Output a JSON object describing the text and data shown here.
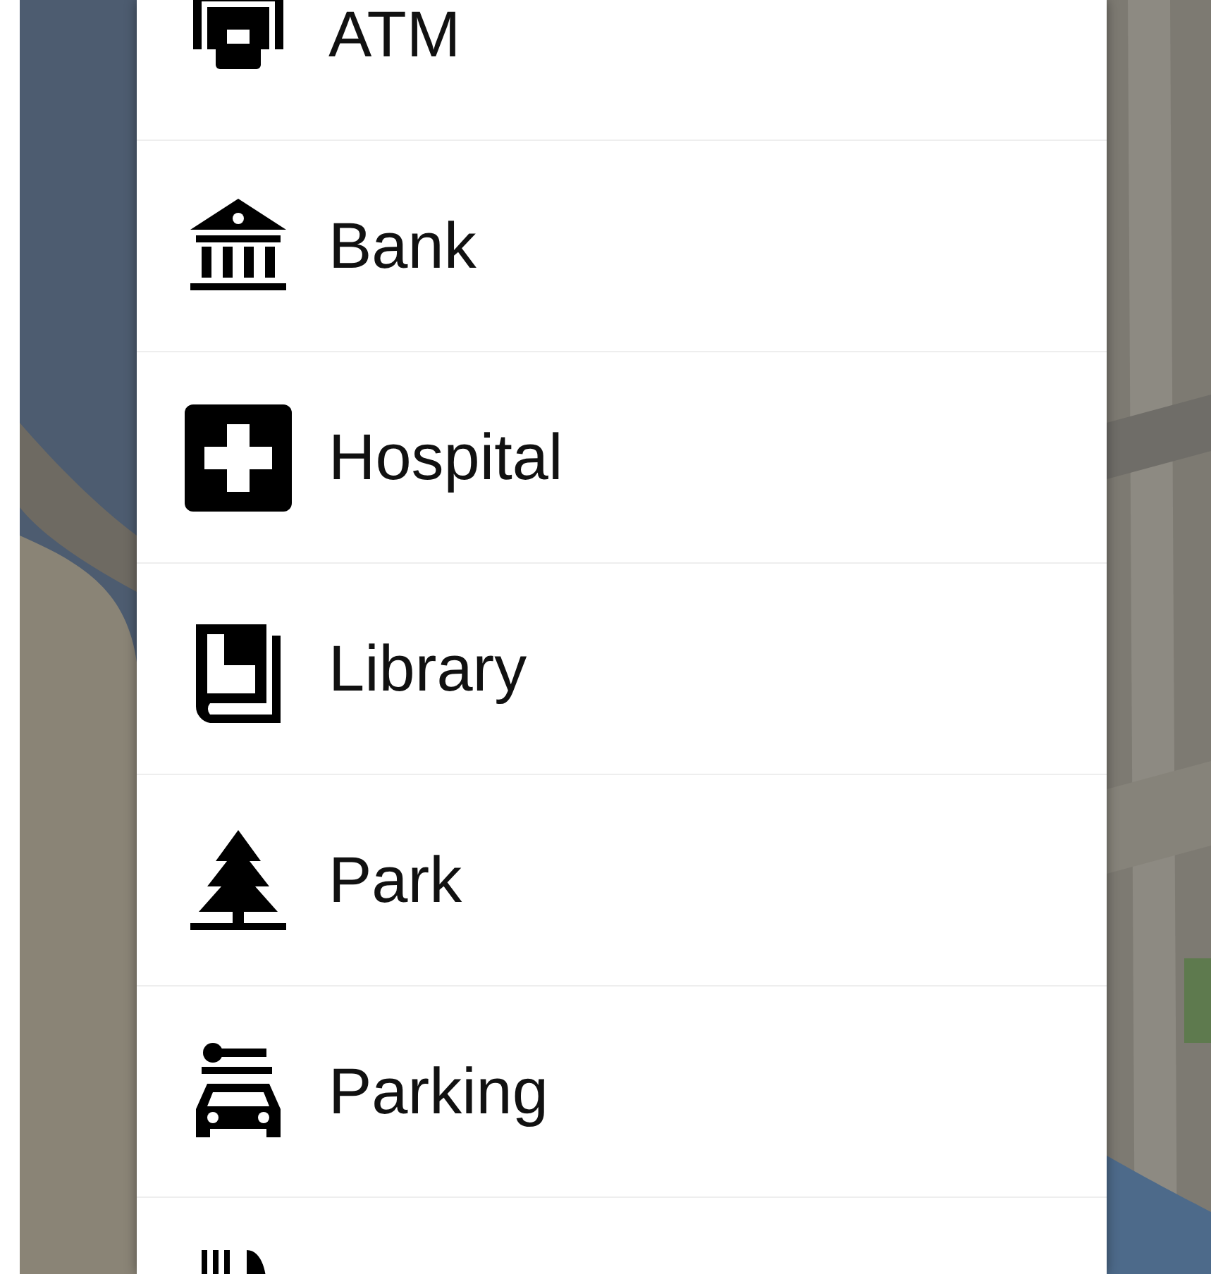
{
  "places": [
    {
      "kind": "atm",
      "label": "ATM"
    },
    {
      "kind": "bank",
      "label": "Bank"
    },
    {
      "kind": "hospital",
      "label": "Hospital"
    },
    {
      "kind": "library",
      "label": "Library"
    },
    {
      "kind": "park",
      "label": "Park"
    },
    {
      "kind": "parking",
      "label": "Parking"
    },
    {
      "kind": "restaurant"
    }
  ]
}
